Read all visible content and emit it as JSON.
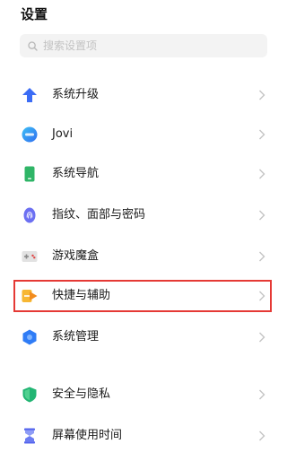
{
  "page": {
    "title": "设置"
  },
  "search": {
    "placeholder": "搜索设置项",
    "icon": "search-icon"
  },
  "items": [
    {
      "label": "系统升级",
      "icon": "arrow-up-icon",
      "color": "#3b6cf5"
    },
    {
      "label": "Jovi",
      "icon": "jovi-icon",
      "color": "#3a8cf0"
    },
    {
      "label": "系统导航",
      "icon": "phone-navigation-icon",
      "color": "#2fb567"
    },
    {
      "label": "指纹、面部与密码",
      "icon": "fingerprint-icon",
      "color": "#5b5ff0"
    },
    {
      "label": "游戏魔盒",
      "icon": "game-box-icon",
      "color": "#e0e0e0"
    },
    {
      "label": "快捷与辅助",
      "icon": "shortcut-icon",
      "color": "#f5a623"
    },
    {
      "label": "系统管理",
      "icon": "system-management-icon",
      "color": "#2f7cf6"
    },
    {
      "label": "安全与隐私",
      "icon": "shield-icon",
      "color": "#22b573"
    },
    {
      "label": "屏幕使用时间",
      "icon": "hourglass-icon",
      "color": "#5566ee"
    }
  ],
  "highlight_color": "#e53935",
  "highlighted_item": "快捷与辅助"
}
